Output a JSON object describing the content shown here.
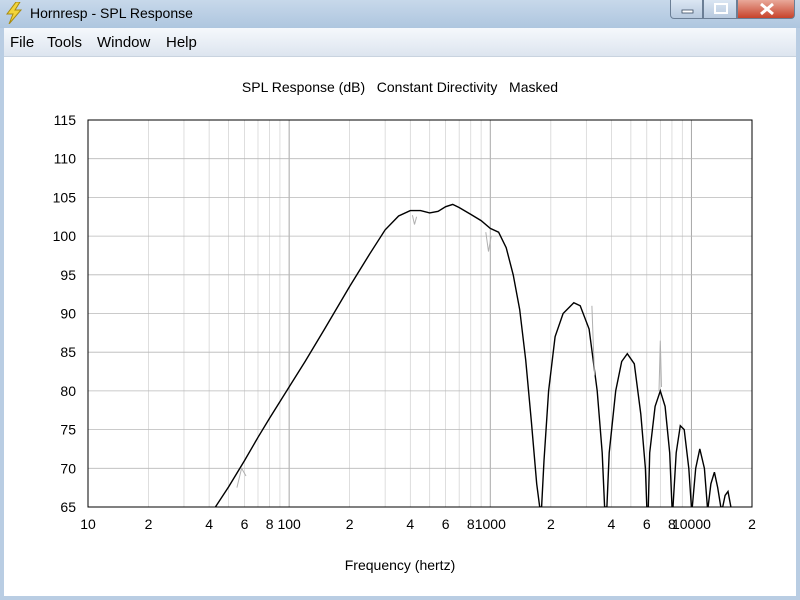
{
  "window": {
    "title": "Hornresp - SPL Response",
    "min_icon": "minimize-icon",
    "max_icon": "maximize-icon",
    "close_icon": "close-icon",
    "app_icon": "lightning-bolt-icon"
  },
  "menu": {
    "items": [
      {
        "label": "File"
      },
      {
        "label": "Tools"
      },
      {
        "label": "Window"
      },
      {
        "label": "Help"
      }
    ]
  },
  "chart_data": {
    "type": "line",
    "title": "SPL Response (dB)   Constant Directivity   Masked",
    "xlabel": "Frequency (hertz)",
    "ylabel": "",
    "x_scale": "log",
    "xlim": [
      10,
      20000
    ],
    "ylim": [
      65,
      115
    ],
    "y_ticks": [
      115,
      110,
      105,
      100,
      95,
      90,
      85,
      80,
      75,
      70,
      65
    ],
    "x_tick_labels": [
      {
        "value": 10,
        "label": "10"
      },
      {
        "value": 20,
        "label": "2"
      },
      {
        "value": 40,
        "label": "4"
      },
      {
        "value": 60,
        "label": "6"
      },
      {
        "value": 80,
        "label": "8"
      },
      {
        "value": 100,
        "label": "100"
      },
      {
        "value": 200,
        "label": "2"
      },
      {
        "value": 400,
        "label": "4"
      },
      {
        "value": 600,
        "label": "6"
      },
      {
        "value": 800,
        "label": "8"
      },
      {
        "value": 1000,
        "label": "1000"
      },
      {
        "value": 2000,
        "label": "2"
      },
      {
        "value": 4000,
        "label": "4"
      },
      {
        "value": 6000,
        "label": "6"
      },
      {
        "value": 8000,
        "label": "8"
      },
      {
        "value": 10000,
        "label": "10000"
      },
      {
        "value": 20000,
        "label": "2"
      }
    ],
    "grid": true,
    "colors": {
      "main": "#000000",
      "masked": "#b0b0b0",
      "grid": "#c8c8c8"
    },
    "series": [
      {
        "values": [
          [
            43,
            65
          ],
          [
            50,
            67.6
          ],
          [
            60,
            71
          ],
          [
            70,
            74
          ],
          [
            80,
            76.5
          ],
          [
            100,
            80.5
          ],
          [
            120,
            83.8
          ],
          [
            150,
            88
          ],
          [
            200,
            93.5
          ],
          [
            250,
            97.6
          ],
          [
            300,
            100.8
          ],
          [
            350,
            102.6
          ],
          [
            400,
            103.3
          ],
          [
            450,
            103.3
          ],
          [
            500,
            103.0
          ],
          [
            550,
            103.2
          ],
          [
            600,
            103.8
          ],
          [
            650,
            104.1
          ],
          [
            700,
            103.7
          ],
          [
            800,
            102.8
          ],
          [
            900,
            102.0
          ],
          [
            1000,
            101.0
          ],
          [
            1100,
            100.5
          ],
          [
            1200,
            98.5
          ],
          [
            1300,
            95.0
          ],
          [
            1400,
            90.5
          ],
          [
            1500,
            84.0
          ],
          [
            1600,
            76.0
          ],
          [
            1700,
            68.0
          ],
          [
            1760,
            65.0
          ],
          [
            1800,
            65.0
          ],
          [
            1850,
            71.0
          ],
          [
            1950,
            80.0
          ],
          [
            2100,
            87.0
          ],
          [
            2300,
            90.0
          ],
          [
            2600,
            91.4
          ],
          [
            2800,
            91.0
          ],
          [
            3100,
            88.0
          ],
          [
            3400,
            80.0
          ],
          [
            3600,
            72.0
          ],
          [
            3700,
            65.0
          ],
          [
            3800,
            65.0
          ],
          [
            3900,
            72.0
          ],
          [
            4200,
            80.0
          ],
          [
            4500,
            83.8
          ],
          [
            4800,
            84.8
          ],
          [
            5200,
            83.5
          ],
          [
            5600,
            77.0
          ],
          [
            5900,
            70.0
          ],
          [
            6000,
            65.0
          ],
          [
            6100,
            65.0
          ],
          [
            6200,
            72.0
          ],
          [
            6600,
            78.0
          ],
          [
            7000,
            80.0
          ],
          [
            7400,
            78.0
          ],
          [
            7800,
            72.0
          ],
          [
            8000,
            65.0
          ],
          [
            8100,
            65.0
          ],
          [
            8400,
            72.0
          ],
          [
            8800,
            75.5
          ],
          [
            9200,
            75.0
          ],
          [
            9700,
            70.0
          ],
          [
            10000,
            65.0
          ],
          [
            10100,
            65.0
          ],
          [
            10500,
            70.0
          ],
          [
            11000,
            72.5
          ],
          [
            11600,
            70.0
          ],
          [
            12000,
            65.0
          ],
          [
            12100,
            65.0
          ],
          [
            12500,
            68.0
          ],
          [
            13000,
            69.5
          ],
          [
            13500,
            67.5
          ],
          [
            14000,
            65.0
          ],
          [
            14300,
            65.0
          ],
          [
            14700,
            66.5
          ],
          [
            15200,
            67.0
          ],
          [
            15700,
            65.0
          ]
        ]
      },
      {
        "values": [
          [
            55,
            67.5
          ],
          [
            58,
            70
          ],
          [
            61,
            69
          ],
          [
            410,
            102.7
          ],
          [
            420,
            101.5
          ],
          [
            430,
            102.5
          ],
          [
            950,
            100.5
          ],
          [
            980,
            98.0
          ],
          [
            1010,
            100.0
          ],
          [
            3200,
            91.0
          ],
          [
            3250,
            86.0
          ],
          [
            3300,
            82.0
          ],
          [
            6900,
            80.0
          ],
          [
            7000,
            86.5
          ],
          [
            7100,
            80.5
          ]
        ]
      }
    ]
  }
}
